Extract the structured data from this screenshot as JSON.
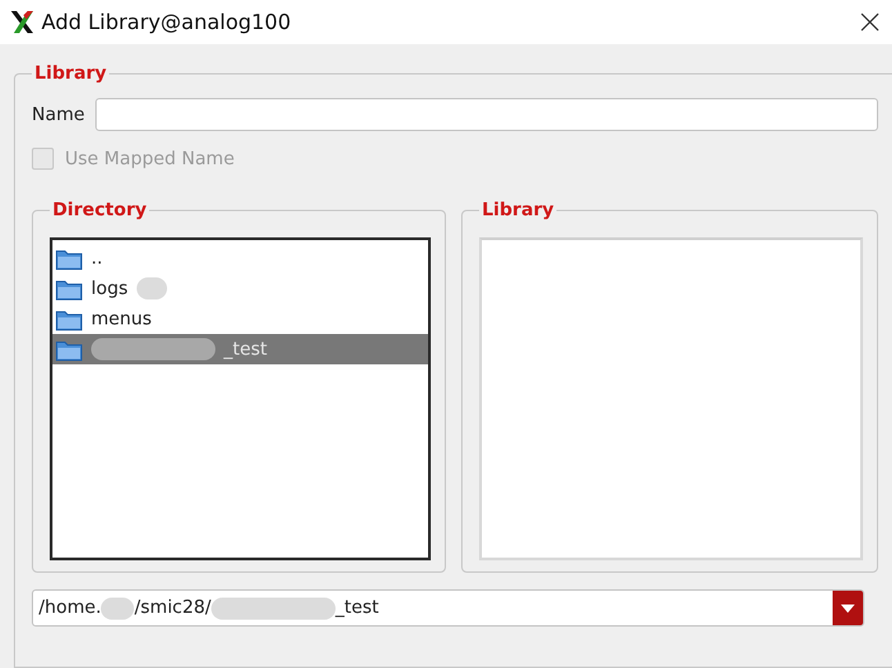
{
  "window": {
    "title": "Add Library@analog100"
  },
  "library_group": {
    "title": "Library",
    "name_label": "Name",
    "use_mapped_name": {
      "label": "Use Mapped Name",
      "checked": false,
      "disabled": true
    }
  },
  "directory": {
    "title": "Directory",
    "items": [
      {
        "name": "..",
        "selected": false,
        "redacted_before": false,
        "redacted_after": false
      },
      {
        "name": "logs",
        "selected": false,
        "redacted_before": false,
        "redacted_after": true
      },
      {
        "name": "menus",
        "selected": false,
        "redacted_before": false,
        "redacted_after": false
      },
      {
        "name": "_test",
        "selected": true,
        "redacted_before": true,
        "redacted_after": false
      }
    ]
  },
  "library_list": {
    "title": "Library"
  },
  "path": {
    "parts": [
      "/home.",
      "/smic28/",
      "_test"
    ]
  }
}
